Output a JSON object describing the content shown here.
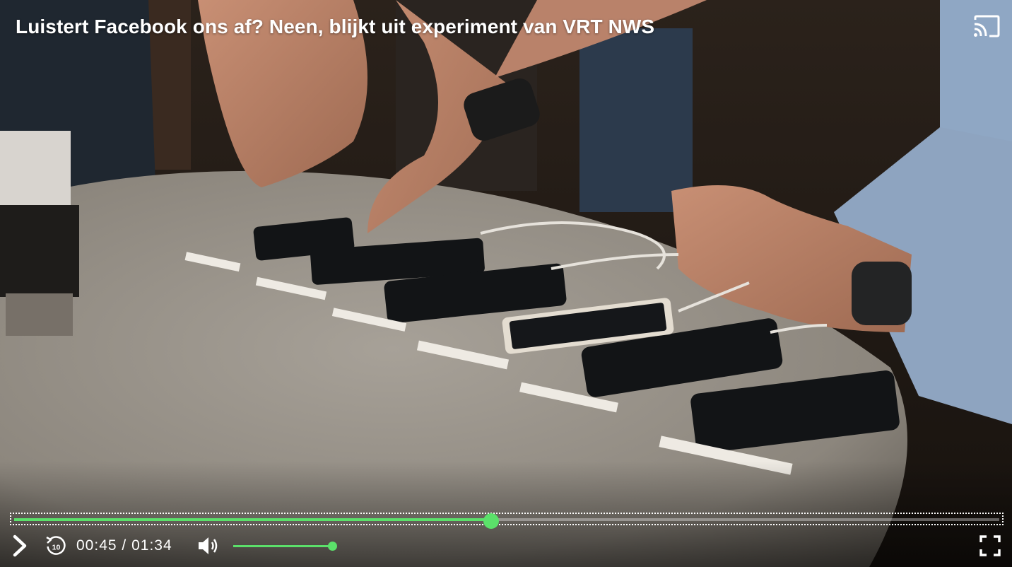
{
  "video": {
    "title": "Luistert Facebook ons af? Neen, blijkt uit experiment van VRT NWS",
    "scene_icon": "video-frame"
  },
  "playback": {
    "current_time": "00:45",
    "separator": "/",
    "duration": "01:34",
    "progress_fraction": 0.484,
    "volume_fraction": 1.0
  },
  "icons": {
    "cast": "cast-icon",
    "play": "play-icon",
    "replay": "replay-10-icon",
    "replay_number": "10",
    "volume": "volume-icon",
    "fullscreen": "fullscreen-icon"
  },
  "colors": {
    "accent": "#5be06a",
    "text": "#ffffff"
  }
}
